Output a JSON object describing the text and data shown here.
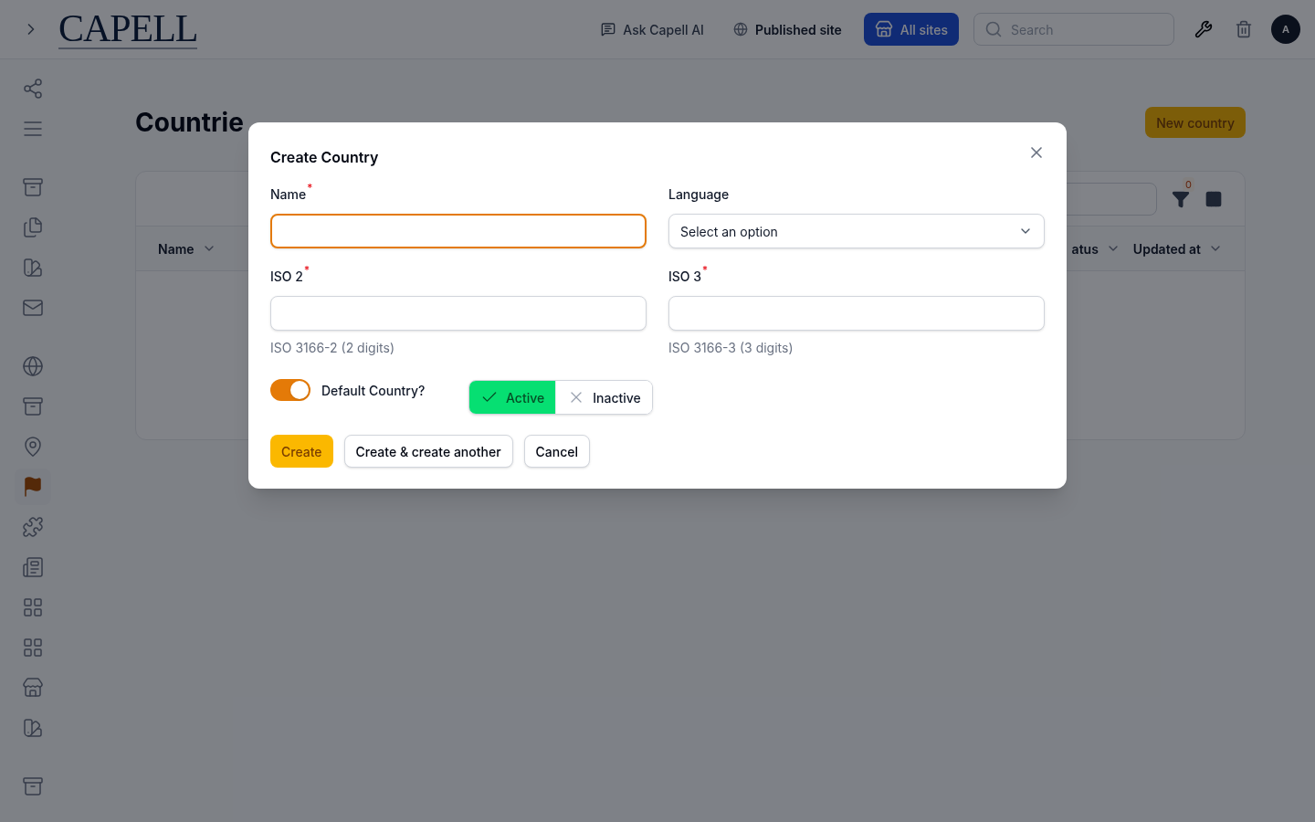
{
  "topbar": {
    "logo": "CAPELL",
    "ask_ai": "Ask Capell AI",
    "published_site": "Published site",
    "all_sites": "All sites",
    "search": {
      "placeholder": "Search"
    },
    "avatar": "A"
  },
  "sidebar": {
    "groups": [
      [
        {
          "selected": false
        },
        {
          "selected": false
        }
      ],
      [
        {
          "selected": false
        },
        {
          "selected": false
        },
        {
          "selected": false
        },
        {
          "selected": false
        }
      ],
      [
        {
          "selected": false
        },
        {
          "selected": false
        },
        {
          "selected": false
        },
        {
          "selected": true
        },
        {
          "selected": false
        },
        {
          "selected": false
        },
        {
          "selected": false
        },
        {
          "selected": false
        },
        {
          "selected": false
        },
        {
          "selected": false
        }
      ],
      [
        {
          "selected": false
        }
      ]
    ]
  },
  "page": {
    "title": "Countrie",
    "new_button": "New country",
    "filter_count": "0",
    "columns_left": [
      {
        "label": "Name"
      }
    ],
    "columns_right": [
      {
        "label": "atus"
      },
      {
        "label": "Updated at"
      }
    ]
  },
  "modal": {
    "title": "Create Country",
    "fields": [
      {
        "kind": "text",
        "label": "Name",
        "required_mark": "*",
        "focused": true
      },
      {
        "kind": "select",
        "label": "Language",
        "focused": false,
        "value": "Select an option"
      },
      {
        "kind": "text",
        "label": "ISO 2",
        "required_mark": "*",
        "focused": false,
        "hint": "ISO 3166-2 (2 digits)"
      },
      {
        "kind": "text",
        "label": "ISO 3",
        "required_mark": "*",
        "focused": false,
        "hint": "ISO 3166-3 (3 digits)"
      }
    ],
    "toggle": {
      "label": "Default Country?",
      "on": true
    },
    "status": [
      {
        "kind": "check",
        "label": "Active",
        "selected": true
      },
      {
        "kind": "cross",
        "label": "Inactive",
        "selected": false
      }
    ],
    "buttons": [
      {
        "kind": "primary",
        "label": "Create"
      },
      {
        "kind": "secondary",
        "label": "Create & create another"
      },
      {
        "kind": "secondary",
        "label": "Cancel"
      }
    ]
  }
}
